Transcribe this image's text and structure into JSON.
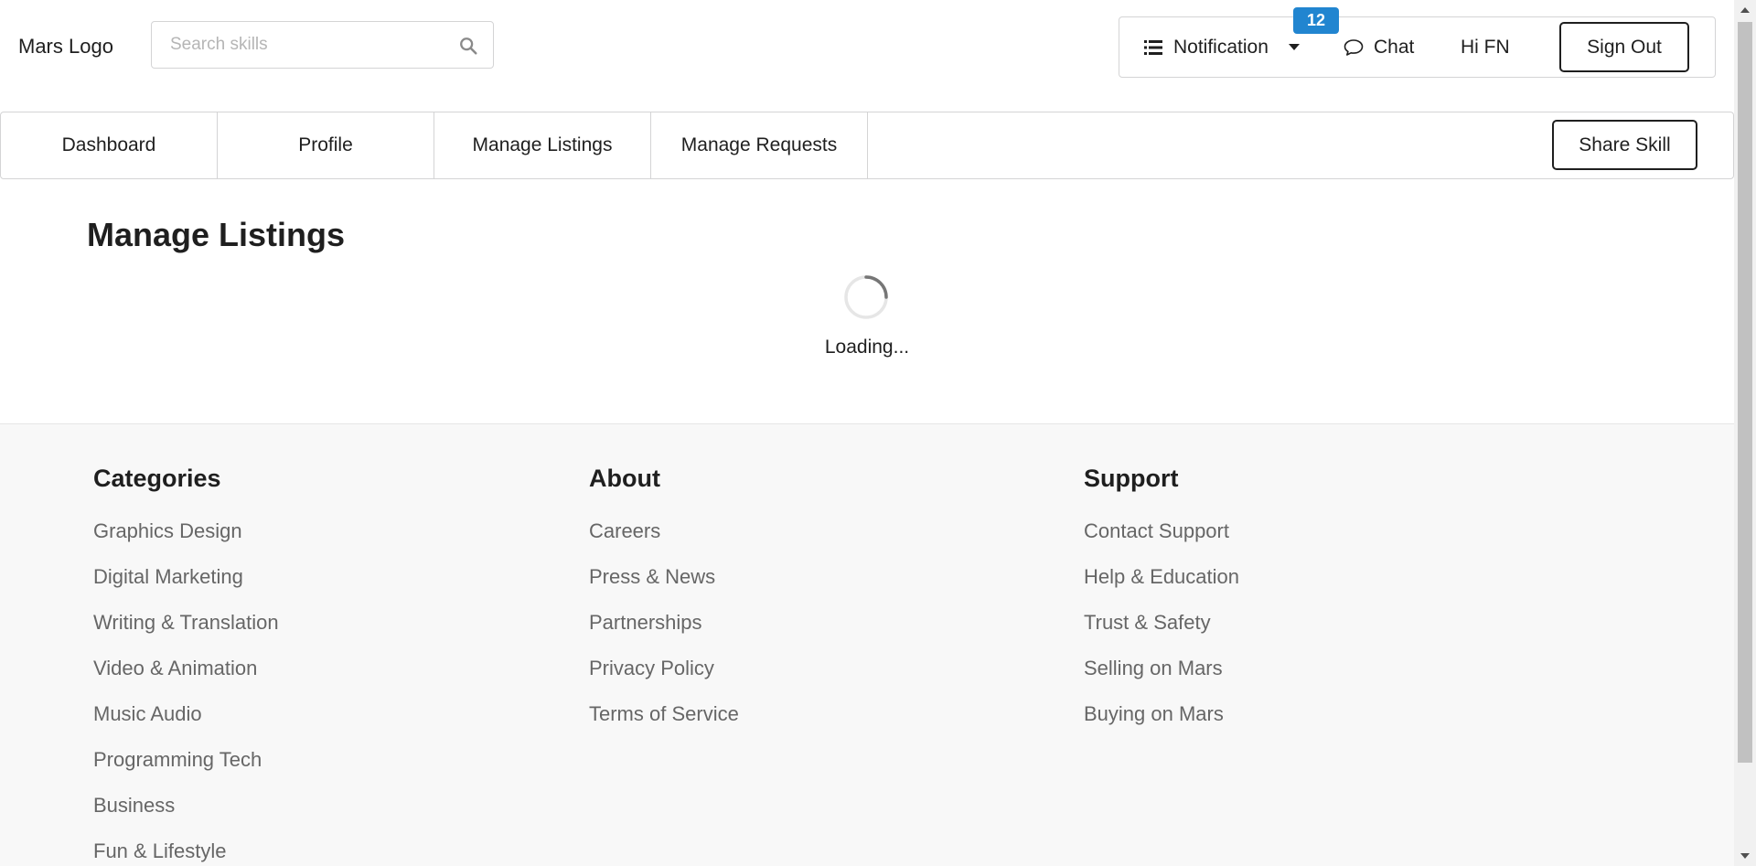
{
  "header": {
    "logo": "Mars Logo",
    "search": {
      "placeholder": "Search skills",
      "value": ""
    },
    "notification": {
      "label": "Notification",
      "count": "12"
    },
    "chat_label": "Chat",
    "greeting": "Hi FN",
    "signout_label": "Sign Out"
  },
  "tabs": [
    "Dashboard",
    "Profile",
    "Manage Listings",
    "Manage Requests"
  ],
  "share_label": "Share Skill",
  "main": {
    "title": "Manage Listings",
    "loading_text": "Loading..."
  },
  "footer": {
    "columns": [
      {
        "heading": "Categories",
        "links": [
          "Graphics Design",
          "Digital Marketing",
          "Writing & Translation",
          "Video & Animation",
          "Music Audio",
          "Programming Tech",
          "Business",
          "Fun & Lifestyle"
        ]
      },
      {
        "heading": "About",
        "links": [
          "Careers",
          "Press & News",
          "Partnerships",
          "Privacy Policy",
          "Terms of Service"
        ]
      },
      {
        "heading": "Support",
        "links": [
          "Contact Support",
          "Help & Education",
          "Trust & Safety",
          "Selling on Mars",
          "Buying on Mars"
        ]
      }
    ]
  },
  "colors": {
    "badge": "#2185d0",
    "footer_bg": "#f8f8f8",
    "footer_link": "#666666",
    "border": "#d4d4d5"
  },
  "icons": {
    "search": "search-icon",
    "notification": "list-icon",
    "dropdown": "caret-down-icon",
    "chat": "chat-bubble-icon",
    "loading": "spinner-icon"
  }
}
